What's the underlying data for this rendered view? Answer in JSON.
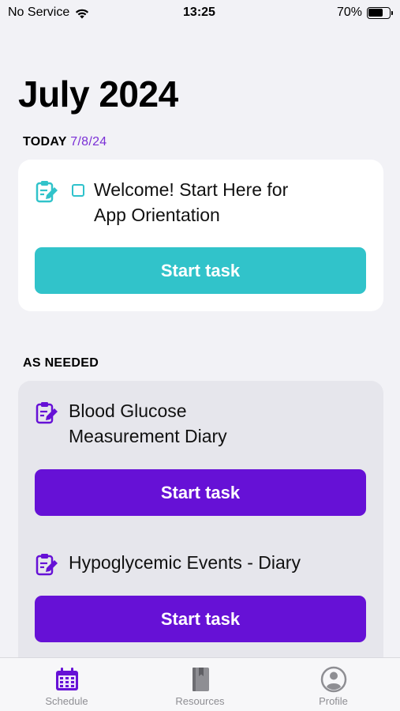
{
  "status_bar": {
    "carrier": "No Service",
    "time": "13:25",
    "battery": "70%",
    "battery_level": 0.7
  },
  "header": {
    "title": "July 2024"
  },
  "today": {
    "label": "TODAY",
    "date": "7/8/24",
    "task": {
      "title_line1": "Welcome! Start Here for",
      "title_line2": "App Orientation",
      "button_label": "Start task",
      "icon": "clipboard-pencil-icon"
    }
  },
  "as_needed": {
    "label": "AS NEEDED",
    "tasks": [
      {
        "title_line1": "Blood Glucose",
        "title_line2": "Measurement Diary",
        "button_label": "Start task",
        "icon": "clipboard-pencil-icon"
      },
      {
        "title_line1": "Hypoglycemic Events - Diary",
        "button_label": "Start task",
        "icon": "clipboard-pencil-icon"
      }
    ]
  },
  "tab_bar": {
    "tabs": [
      {
        "label": "Schedule",
        "icon": "calendar-icon",
        "active": true
      },
      {
        "label": "Resources",
        "icon": "book-icon",
        "active": false
      },
      {
        "label": "Profile",
        "icon": "person-circle-icon",
        "active": false
      }
    ]
  },
  "colors": {
    "teal": "#31c3ca",
    "purple": "#6611d6",
    "date_accent": "#7a2fd6"
  }
}
